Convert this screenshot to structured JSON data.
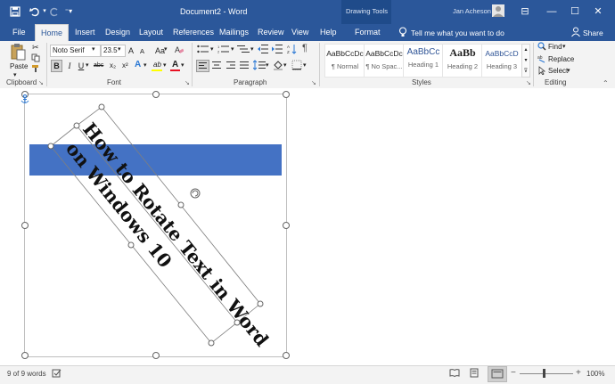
{
  "titlebar": {
    "doc_title": "Document2 - Word",
    "context_group": "Drawing Tools",
    "user_name": "Jan Acheson",
    "save_icon": "save-icon",
    "undo_icon": "undo-icon",
    "redo_icon": "redo-icon",
    "customize_icon": "customize-icon",
    "minimize": "—",
    "maximize": "☐",
    "close": "✕",
    "ribbon_options": "⊟"
  },
  "tabs": [
    "File",
    "Home",
    "Insert",
    "Design",
    "Layout",
    "References",
    "Mailings",
    "Review",
    "View",
    "Help",
    "Format"
  ],
  "active_tab": "Home",
  "tell_me": "Tell me what you want to do",
  "share": "Share",
  "ribbon": {
    "clipboard": {
      "paste": "Paste",
      "label": "Clipboard"
    },
    "font": {
      "name": "Noto Serif",
      "size": "23.5",
      "grow": "A",
      "shrink": "A",
      "case": "Aa",
      "bold": "B",
      "italic": "I",
      "underline": "U",
      "strike": "abc",
      "sub": "x₂",
      "sup": "x²",
      "effects": "A",
      "highlight": "ab",
      "color": "A",
      "label": "Font"
    },
    "paragraph": {
      "label": "Paragraph",
      "pilcrow": "¶"
    },
    "styles": {
      "label": "Styles",
      "items": [
        {
          "preview": "AaBbCcDc",
          "name": "¶ Normal"
        },
        {
          "preview": "AaBbCcDc",
          "name": "¶ No Spac..."
        },
        {
          "preview": "AaBbCc",
          "name": "Heading 1"
        },
        {
          "preview": "AaBb",
          "name": "Heading 2"
        },
        {
          "preview": "AaBbCcD",
          "name": "Heading 3"
        }
      ]
    },
    "editing": {
      "find": "Find",
      "replace": "Replace",
      "select": "Select",
      "label": "Editing"
    }
  },
  "document": {
    "rotated_text_line1": "How to Rotate Text in Word",
    "rotated_text_line2": "on Windows 10",
    "band_color": "#4472c4"
  },
  "status": {
    "words": "9 of 9 words",
    "zoom": "100%",
    "zoom_minus": "−",
    "zoom_plus": "+"
  }
}
